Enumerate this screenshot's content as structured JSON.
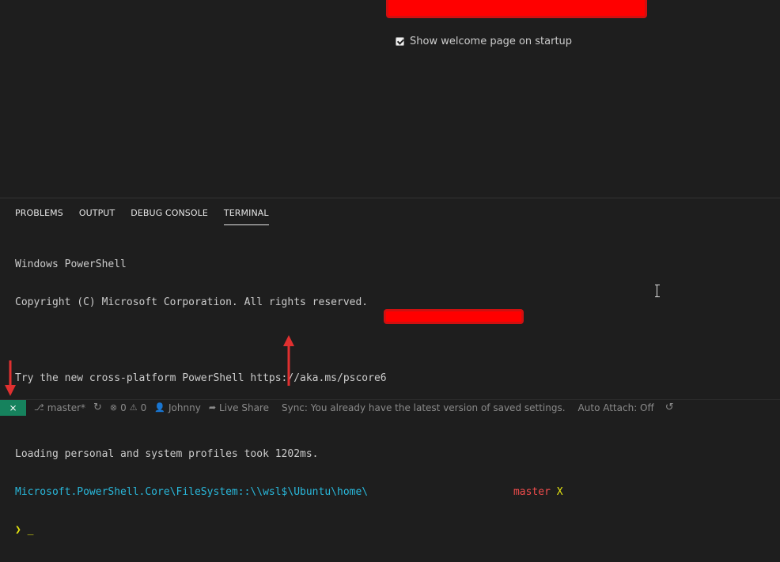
{
  "welcome": {
    "show_on_startup_label": "Show welcome page on startup"
  },
  "panel": {
    "tabs": [
      {
        "label": "PROBLEMS"
      },
      {
        "label": "OUTPUT"
      },
      {
        "label": "DEBUG CONSOLE"
      },
      {
        "label": "TERMINAL"
      }
    ],
    "active_tab": "TERMINAL"
  },
  "terminal": {
    "line1": "Windows PowerShell",
    "line2": "Copyright (C) Microsoft Corporation. All rights reserved.",
    "line3": "Try the new cross-platform PowerShell https://aka.ms/pscore6",
    "line4": "Loading personal and system profiles took 1202ms.",
    "prompt_path": "Microsoft.PowerShell.Core\\FileSystem::\\\\wsl$\\Ubuntu\\home\\",
    "prompt_branch": "master",
    "prompt_status": "X",
    "prompt_symbol": "❯",
    "cursor": "_"
  },
  "statusbar": {
    "remote_icon": "remote-icon",
    "branch": "master*",
    "sync_icon": "sync-icon",
    "errors": "0",
    "warnings": "0",
    "user": "Johnny",
    "live_share": "Live Share",
    "sync_message": "Sync: You already have the latest version of saved settings.",
    "auto_attach": "Auto Attach: Off",
    "history_icon": "history-icon"
  },
  "colors": {
    "redaction": "#ff0000",
    "annotation_arrow": "#e03030",
    "remote_bg": "#16825d",
    "path_blue": "#3b8eea",
    "branch_red": "#f14c4c",
    "status_yellow": "#e5e510"
  }
}
